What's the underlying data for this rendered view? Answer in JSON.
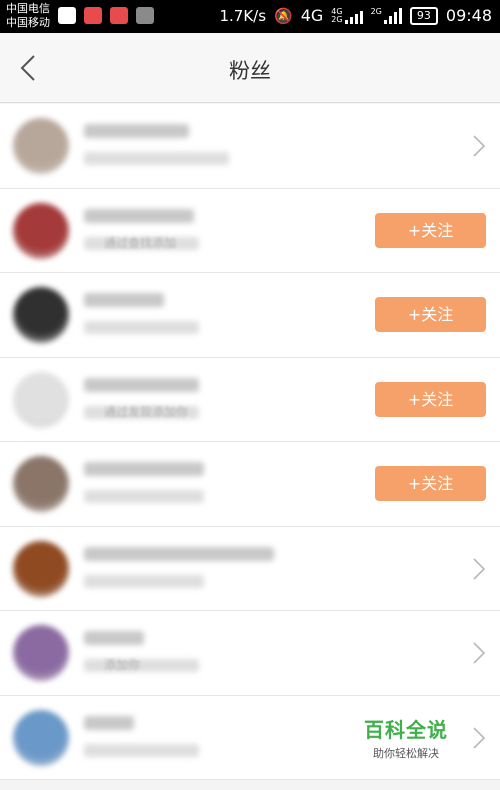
{
  "status_bar": {
    "carrier_1": "中国电信",
    "carrier_2": "中国移动",
    "net_speed": "1.7K/s",
    "network_type": "4G",
    "sig_a": "4G",
    "sig_b": "2G",
    "sig_c": "2G",
    "battery": "93",
    "time": "09:48"
  },
  "header": {
    "title": "粉丝",
    "back_icon": "chevron-left-icon"
  },
  "fans": [
    {
      "action": "chevron",
      "avatar_color": "#b7a79a",
      "subtitle": ""
    },
    {
      "action": "follow",
      "follow_label": "+关注",
      "avatar_color": "#a43a3a",
      "subtitle": "通过查找添加"
    },
    {
      "action": "follow",
      "follow_label": "+关注",
      "avatar_color": "#303030",
      "subtitle": ""
    },
    {
      "action": "follow",
      "follow_label": "+关注",
      "avatar_color": "#e0e0e0",
      "subtitle": "通过发现添加你"
    },
    {
      "action": "follow",
      "follow_label": "+关注",
      "avatar_color": "#8a7568",
      "subtitle": ""
    },
    {
      "action": "chevron",
      "avatar_color": "#8f4a22",
      "subtitle": ""
    },
    {
      "action": "chevron",
      "avatar_color": "#8a6aa0",
      "subtitle": "添加你"
    },
    {
      "action": "chevron",
      "avatar_color": "#6a98c8",
      "subtitle": ""
    }
  ],
  "watermark": {
    "main": "百科全说",
    "sub": "助你轻松解决"
  },
  "colors": {
    "follow_button": "#f6a06a",
    "watermark_green": "#3fb04a"
  }
}
